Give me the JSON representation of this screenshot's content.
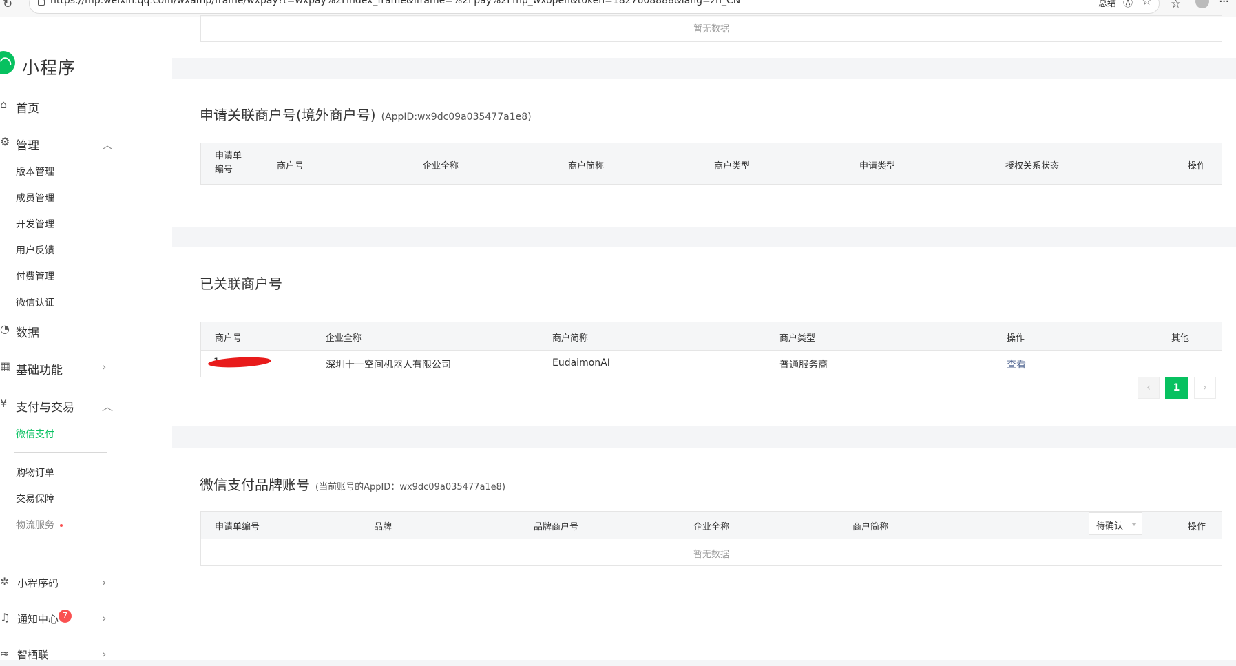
{
  "browser": {
    "url": "https://mp.weixin.qq.com/wxamp/frame/wxpay?t=wxpay%2Findex_frame&iframe=%2Fpay%2Fmp_wxopen&token=1827608888&lang=zh_CN",
    "right_label": "总结"
  },
  "sidebar": {
    "logo_text": "小程序",
    "home": "首页",
    "manage": "管理",
    "manage_items": [
      "版本管理",
      "成员管理",
      "开发管理",
      "用户反馈",
      "付费管理",
      "微信认证"
    ],
    "data": "数据",
    "basic": "基础功能",
    "pay": "支付与交易",
    "pay_items": [
      "微信支付",
      "购物订单",
      "交易保障",
      "物流服务"
    ],
    "qrcode": "小程序码",
    "notify": "通知中心",
    "notify_count": "7",
    "smart": "智栖联"
  },
  "top_card": {
    "empty_text": "暂无数据"
  },
  "apply_card": {
    "title": "申请关联商户号(境外商户号)",
    "appid_note": "(AppID:wx9dc09a035477a1e8)",
    "headers": [
      "申请单编号",
      "商户号",
      "企业全称",
      "商户简称",
      "商户类型",
      "申请类型",
      "授权关系状态",
      "操作"
    ]
  },
  "linked_card": {
    "title": "已关联商户号",
    "headers": [
      "商户号",
      "企业全称",
      "商户简称",
      "商户类型",
      "操作",
      "其他"
    ],
    "row": {
      "merchant_id": "1",
      "company": "深圳十一空间机器人有限公司",
      "short_name": "EudaimonAI",
      "type": "普通服务商",
      "action": "查看"
    },
    "pager": {
      "prev": "‹",
      "page": "1",
      "next": "›"
    }
  },
  "brand_card": {
    "title": "微信支付品牌账号",
    "appid_note": "(当前账号的AppID：wx9dc09a035477a1e8)",
    "headers": [
      "申请单编号",
      "品牌",
      "品牌商户号",
      "企业全称",
      "商户简称",
      "操作"
    ],
    "status_filter": "待确认",
    "empty_text": "暂无数据"
  },
  "colors": {
    "accent": "#07c160",
    "link": "#576b95",
    "badge": "#fa5151"
  }
}
